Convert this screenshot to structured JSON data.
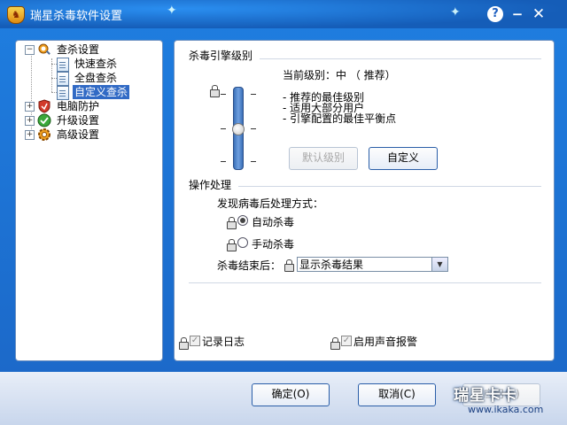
{
  "window": {
    "title": "瑞星杀毒软件设置",
    "icons": {
      "app": "shield-app-icon",
      "help": "help-icon",
      "minimize": "minimize-icon",
      "close": "close-icon"
    },
    "help_glyph": "?",
    "minimize_glyph": "−",
    "close_glyph": "✕"
  },
  "tree": {
    "items": [
      {
        "label": "查杀设置",
        "expanded": true,
        "icon": "search-settings-icon",
        "expander": "−"
      },
      {
        "label": "快速查杀",
        "child": true,
        "icon": "document-icon"
      },
      {
        "label": "全盘查杀",
        "child": true,
        "icon": "document-icon"
      },
      {
        "label": "自定义查杀",
        "child": true,
        "icon": "document-icon",
        "selected": true
      },
      {
        "label": "电脑防护",
        "icon": "shield-icon",
        "expander": "+"
      },
      {
        "label": "升级设置",
        "icon": "upgrade-icon",
        "expander": "+"
      },
      {
        "label": "高级设置",
        "icon": "gear-icon",
        "expander": "+"
      }
    ]
  },
  "engine": {
    "section_title": "杀毒引擎级别",
    "current_level_label": "当前级别：中 （ 推荐）",
    "level_value": "middle",
    "descriptions": [
      "- 推荐的最佳级别",
      "- 适用大部分用户",
      "- 引擎配置的最佳平衡点"
    ],
    "default_button": "默认级别",
    "custom_button": "自定义",
    "tick": "-"
  },
  "operation": {
    "section_title": "操作处理",
    "prompt": "发现病毒后处理方式：",
    "options": [
      {
        "label": "自动杀毒",
        "checked": true
      },
      {
        "label": "手动杀毒",
        "checked": false
      }
    ],
    "after_label": "杀毒结束后：",
    "after_value": "显示杀毒结果"
  },
  "bottom_options": {
    "log_label": "记录日志",
    "sound_label": "启用声音报警",
    "check_glyph": "✓"
  },
  "buttons": {
    "ok": "确定(O)",
    "cancel": "取消(C)",
    "apply": "应用(A)"
  },
  "watermark": {
    "brand": "瑞星卡卡",
    "url": "www.ikaka.com"
  },
  "colors": {
    "title_bar": "#1d6fd2",
    "selection": "#316ac5",
    "panel_border": "#6a8fc0"
  }
}
